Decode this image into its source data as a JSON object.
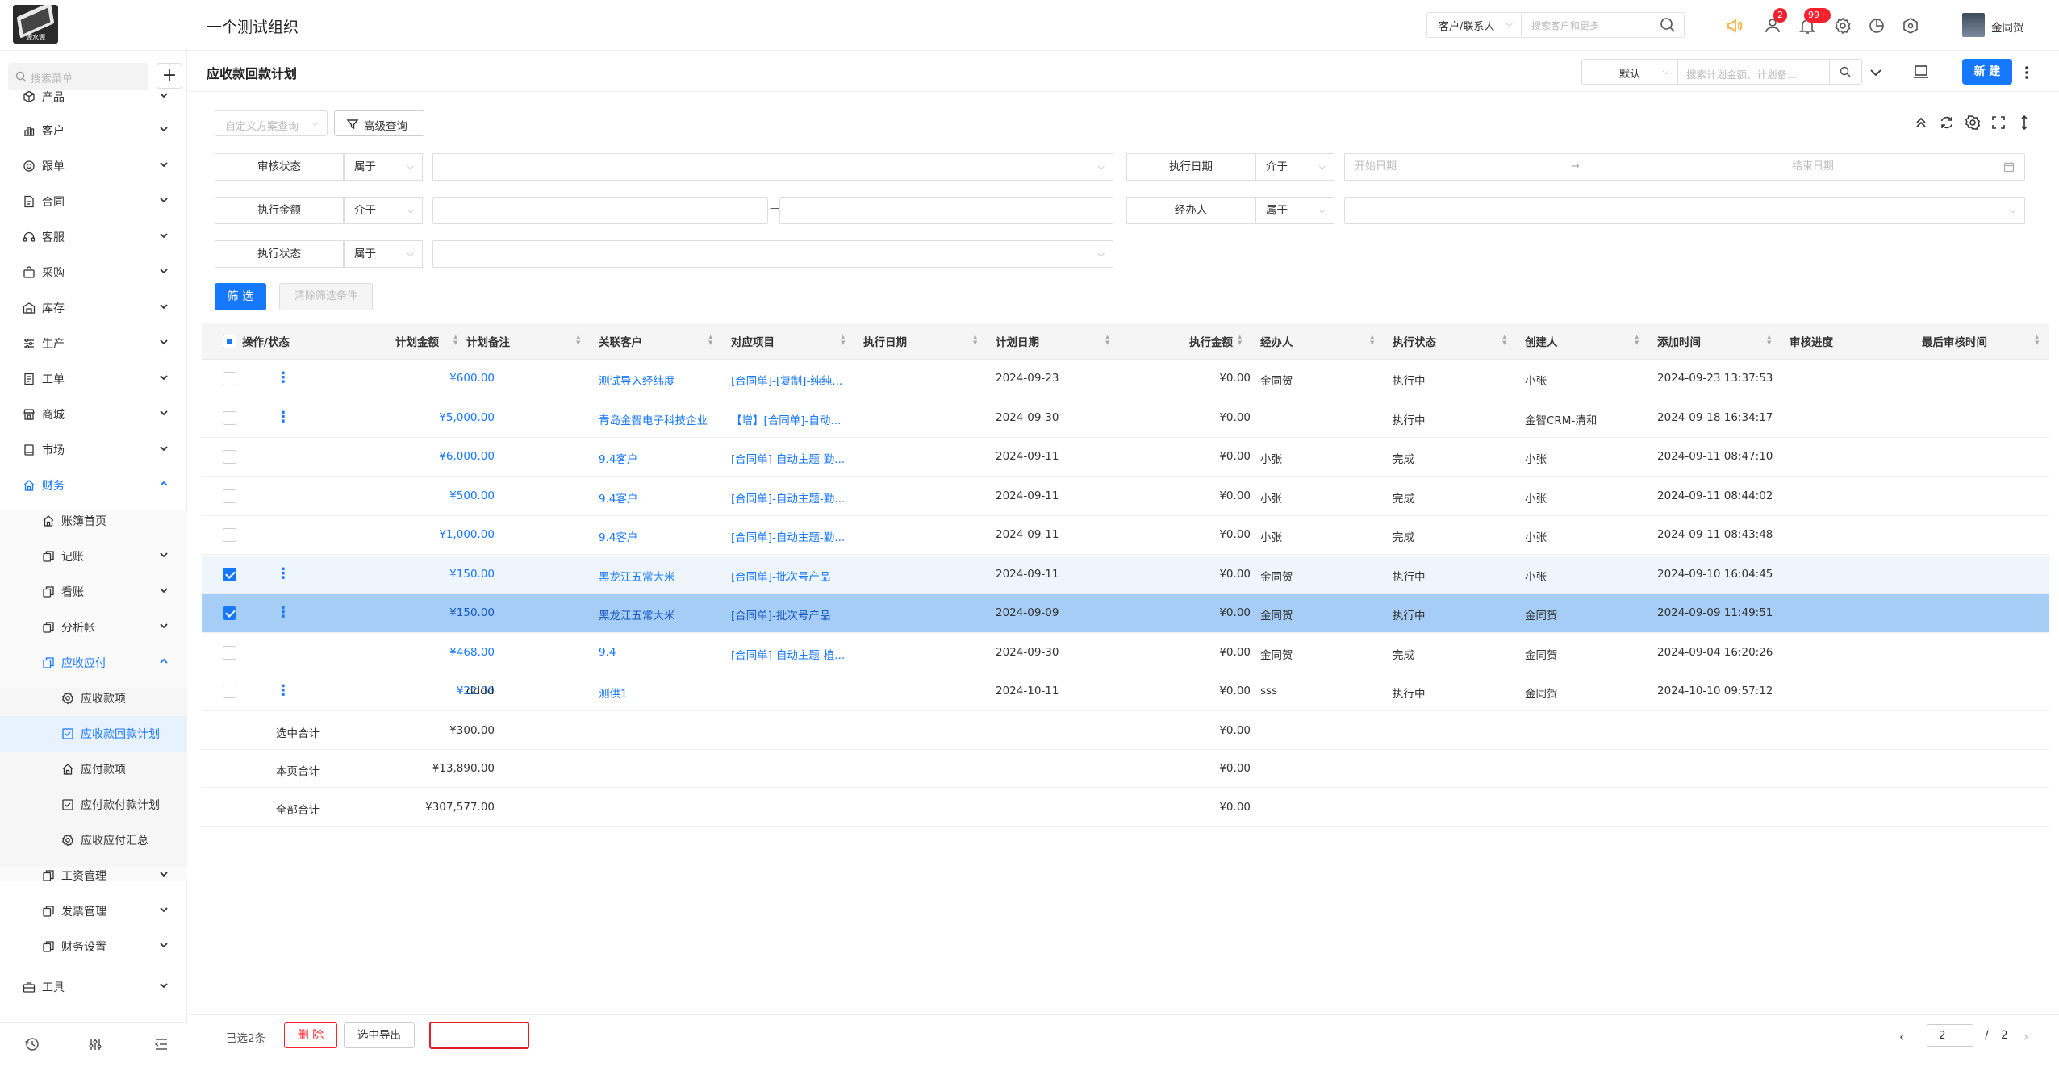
{
  "app": {
    "logo_text": "源水源",
    "org_name": "一个测试组织",
    "user_name": "金同贺"
  },
  "topbar": {
    "search_type": "客户/联系人",
    "search_placeholder": "搜索客户和更多",
    "badges": {
      "contacts": "2",
      "notifications": "99+"
    },
    "colors": {
      "accent": "#1677ff",
      "badge": "#f5222d",
      "speaker": "#f5a623"
    }
  },
  "sidebar": {
    "search_placeholder": "搜索菜单",
    "items": [
      {
        "key": "product",
        "label": "产品",
        "icon": "cube-icon",
        "level": 1,
        "expanded": false
      },
      {
        "key": "customer",
        "label": "客户",
        "icon": "chart-icon",
        "level": 1,
        "expanded": false
      },
      {
        "key": "follow",
        "label": "跟单",
        "icon": "target-icon",
        "level": 1,
        "expanded": false
      },
      {
        "key": "contract",
        "label": "合同",
        "icon": "doc-icon",
        "level": 1,
        "expanded": false
      },
      {
        "key": "service",
        "label": "客服",
        "icon": "headset-icon",
        "level": 1,
        "expanded": false
      },
      {
        "key": "purchase",
        "label": "采购",
        "icon": "bag-icon",
        "level": 1,
        "expanded": false
      },
      {
        "key": "stock",
        "label": "库存",
        "icon": "warehouse-icon",
        "level": 1,
        "expanded": false
      },
      {
        "key": "production",
        "label": "生产",
        "icon": "sliders-icon",
        "level": 1,
        "expanded": false
      },
      {
        "key": "workorder",
        "label": "工单",
        "icon": "file-icon",
        "level": 1,
        "expanded": false
      },
      {
        "key": "mall",
        "label": "商城",
        "icon": "shop-icon",
        "level": 1,
        "expanded": false
      },
      {
        "key": "market",
        "label": "市场",
        "icon": "book-icon",
        "level": 1,
        "expanded": false
      },
      {
        "key": "finance",
        "label": "财务",
        "icon": "home-icon",
        "level": 1,
        "expanded": true,
        "active": true
      },
      {
        "key": "ledger_home",
        "label": "账簿首页",
        "icon": "home-icon",
        "level": 2
      },
      {
        "key": "bookkeep",
        "label": "记账",
        "icon": "copy-icon",
        "level": 2,
        "expanded": false
      },
      {
        "key": "viewacc",
        "label": "看账",
        "icon": "copy-icon",
        "level": 2,
        "expanded": false
      },
      {
        "key": "analysis",
        "label": "分析帐",
        "icon": "copy-icon",
        "level": 2,
        "expanded": false
      },
      {
        "key": "arap",
        "label": "应收应付",
        "icon": "copy-icon",
        "level": 2,
        "expanded": true,
        "active": true
      },
      {
        "key": "receivables",
        "label": "应收款项",
        "icon": "gear-icon",
        "level": 3
      },
      {
        "key": "recv_plan",
        "label": "应收款回款计划",
        "icon": "plan-icon",
        "level": 3,
        "selected": true
      },
      {
        "key": "payables",
        "label": "应付款项",
        "icon": "home-icon",
        "level": 3
      },
      {
        "key": "pay_plan",
        "label": "应付款付款计划",
        "icon": "plan-icon",
        "level": 3
      },
      {
        "key": "arap_summary",
        "label": "应收应付汇总",
        "icon": "gear-icon",
        "level": 3
      },
      {
        "key": "salary",
        "label": "工资管理",
        "icon": "copy-icon",
        "level": 2,
        "expanded": false
      },
      {
        "key": "invoice",
        "label": "发票管理",
        "icon": "copy-icon",
        "level": 2,
        "expanded": false
      },
      {
        "key": "fin_settings",
        "label": "财务设置",
        "icon": "copy-icon",
        "level": 2,
        "expanded": false
      },
      {
        "key": "tools",
        "label": "工具",
        "icon": "toolbox-icon",
        "level": 1,
        "expanded": false
      }
    ]
  },
  "page": {
    "title": "应收款回款计划",
    "view_select": "默认",
    "search_placeholder": "搜索计划金额、计划备...",
    "new_label": "新 建"
  },
  "filters": {
    "scheme_placeholder": "自定义方案查询",
    "advanced_label": "高级查询",
    "rows": [
      {
        "label": "审核状态",
        "op": "属于"
      },
      {
        "label": "执行日期",
        "op": "介于",
        "start_placeholder": "开始日期",
        "end_placeholder": "结束日期",
        "range_sep": "→"
      },
      {
        "label": "执行金额",
        "op": "介于",
        "range_sep": "—"
      },
      {
        "label": "经办人",
        "op": "属于"
      },
      {
        "label": "执行状态",
        "op": "属于"
      }
    ],
    "filter_btn": "筛 选",
    "clear_btn": "清除筛选条件"
  },
  "table": {
    "columns": [
      "操作/状态",
      "计划金额",
      "计划备注",
      "关联客户",
      "对应项目",
      "执行日期",
      "计划日期",
      "执行金额",
      "经办人",
      "执行状态",
      "创建人",
      "添加时间",
      "审核进度",
      "最后审核时间"
    ],
    "rows": [
      {
        "checked": false,
        "menu": true,
        "amount": "¥600.00",
        "note": "",
        "customer": "测试导入经纬度",
        "project": "[合同单]-[复制]-纯纯...",
        "exec_date": "",
        "plan_date": "2024-09-23",
        "exec_amount": "¥0.00",
        "handler": "金同贺",
        "status": "执行中",
        "creator": "小张",
        "added": "2024-09-23 13:37:53",
        "state": "normal"
      },
      {
        "checked": false,
        "menu": true,
        "amount": "¥5,000.00",
        "note": "",
        "customer": "青岛金智电子科技企业",
        "project": "【增】[合同单]-自动...",
        "exec_date": "",
        "plan_date": "2024-09-30",
        "exec_amount": "¥0.00",
        "handler": "",
        "status": "执行中",
        "creator": "金智CRM-清和",
        "added": "2024-09-18 16:34:17",
        "state": "normal"
      },
      {
        "checked": false,
        "menu": false,
        "amount": "¥6,000.00",
        "note": "",
        "customer": "9.4客户",
        "project": "[合同单]-自动主题-勤...",
        "exec_date": "",
        "plan_date": "2024-09-11",
        "exec_amount": "¥0.00",
        "handler": "小张",
        "status": "完成",
        "creator": "小张",
        "added": "2024-09-11 08:47:10",
        "state": "normal"
      },
      {
        "checked": false,
        "menu": false,
        "amount": "¥500.00",
        "note": "",
        "customer": "9.4客户",
        "project": "[合同单]-自动主题-勤...",
        "exec_date": "",
        "plan_date": "2024-09-11",
        "exec_amount": "¥0.00",
        "handler": "小张",
        "status": "完成",
        "creator": "小张",
        "added": "2024-09-11 08:44:02",
        "state": "normal"
      },
      {
        "checked": false,
        "menu": false,
        "amount": "¥1,000.00",
        "note": "",
        "customer": "9.4客户",
        "project": "[合同单]-自动主题-勤...",
        "exec_date": "",
        "plan_date": "2024-09-11",
        "exec_amount": "¥0.00",
        "handler": "小张",
        "status": "完成",
        "creator": "小张",
        "added": "2024-09-11 08:43:48",
        "state": "normal"
      },
      {
        "checked": true,
        "menu": true,
        "amount": "¥150.00",
        "note": "",
        "customer": "黑龙江五常大米",
        "project": "[合同单]-批次号产品",
        "exec_date": "",
        "plan_date": "2024-09-11",
        "exec_amount": "¥0.00",
        "handler": "金同贺",
        "status": "执行中",
        "creator": "小张",
        "added": "2024-09-10 16:04:45",
        "state": "hover"
      },
      {
        "checked": true,
        "menu": true,
        "amount": "¥150.00",
        "note": "",
        "customer": "黑龙江五常大米",
        "project": "[合同单]-批次号产品",
        "exec_date": "",
        "plan_date": "2024-09-09",
        "exec_amount": "¥0.00",
        "handler": "金同贺",
        "status": "执行中",
        "creator": "金同贺",
        "added": "2024-09-09 11:49:51",
        "state": "selected"
      },
      {
        "checked": false,
        "menu": false,
        "amount": "¥468.00",
        "note": "",
        "customer": "9.4",
        "project": "[合同单]-自动主题-植...",
        "exec_date": "",
        "plan_date": "2024-09-30",
        "exec_amount": "¥0.00",
        "handler": "金同贺",
        "status": "完成",
        "creator": "金同贺",
        "added": "2024-09-04 16:20:26",
        "state": "normal"
      },
      {
        "checked": false,
        "menu": true,
        "amount": "¥22.00",
        "note": "dddd",
        "customer": "测供1",
        "project": "",
        "exec_date": "",
        "plan_date": "2024-10-11",
        "exec_amount": "¥0.00",
        "handler": "sss",
        "status": "执行中",
        "creator": "金同贺",
        "added": "2024-10-10 09:57:12",
        "state": "normal"
      }
    ],
    "summary": [
      {
        "label": "选中合计",
        "amount": "¥300.00",
        "exec_amount": "¥0.00"
      },
      {
        "label": "本页合计",
        "amount": "¥13,890.00",
        "exec_amount": "¥0.00"
      },
      {
        "label": "全部合计",
        "amount": "¥307,577.00",
        "exec_amount": "¥0.00"
      }
    ]
  },
  "footer": {
    "selected_text": "已选2条",
    "delete_label": "删 除",
    "export_label": "选中导出",
    "page_current": "2",
    "page_sep": "/",
    "page_total": "2"
  }
}
